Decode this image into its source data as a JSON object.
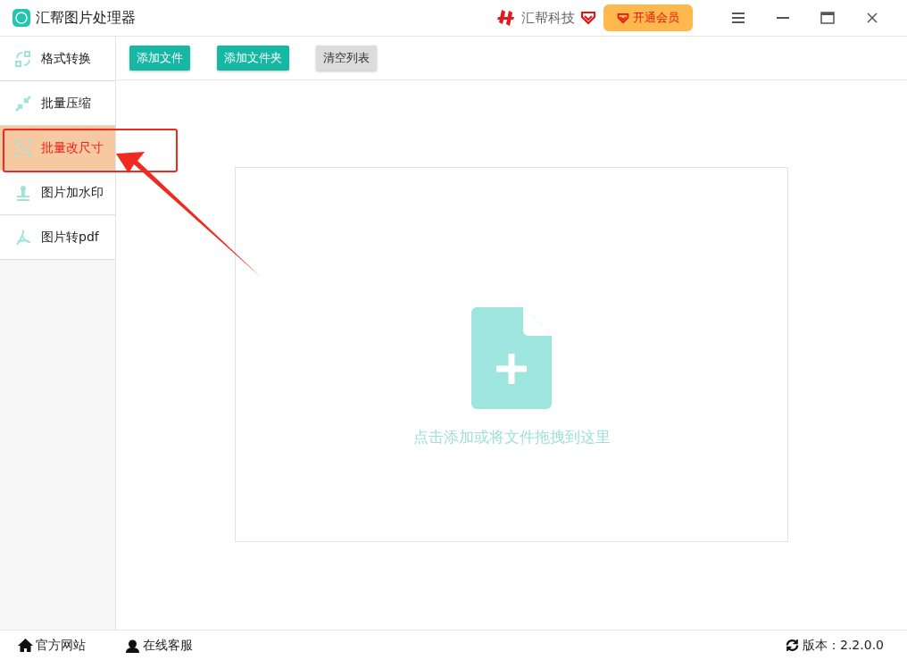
{
  "window": {
    "title": "汇帮图片处理器",
    "brand": "汇帮科技",
    "vip_button": "开通会员"
  },
  "sidebar": {
    "items": [
      {
        "label": "格式转换",
        "kind": "convert",
        "selected": false
      },
      {
        "label": "批量压缩",
        "kind": "compress",
        "selected": false
      },
      {
        "label": "批量改尺寸",
        "kind": "resize",
        "selected": true
      },
      {
        "label": "图片加水印",
        "kind": "watermark",
        "selected": false
      },
      {
        "label": "图片转pdf",
        "kind": "pdf",
        "selected": false
      }
    ]
  },
  "toolbar": {
    "buttons": [
      {
        "label": "添加文件",
        "kind": "primary"
      },
      {
        "label": "添加文件夹",
        "kind": "primary"
      },
      {
        "label": "清空列表",
        "kind": "secondary"
      }
    ]
  },
  "drop_zone": {
    "hint": "点击添加或将文件拖拽到这里"
  },
  "status_bar": {
    "website": "官方网站",
    "support": "在线客服",
    "version": "版本：2.2.0.0"
  }
}
